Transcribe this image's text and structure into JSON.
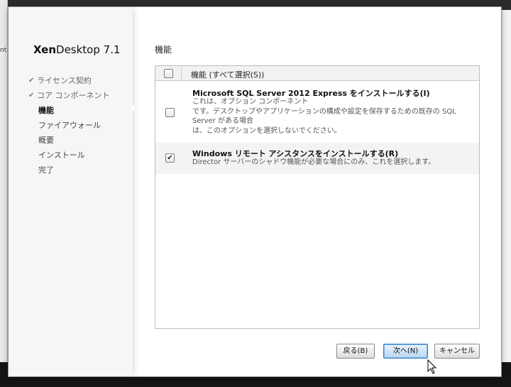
{
  "background": {
    "left_fragment_text": "nt"
  },
  "sidebar": {
    "product_bold": "Xen",
    "product_rest": "Desktop 7.1",
    "steps": [
      {
        "label": "ライセンス契約",
        "status": "done"
      },
      {
        "label": "コア コンポーネント",
        "status": "done"
      },
      {
        "label": "機能",
        "status": "current"
      },
      {
        "label": "ファイアウォール",
        "status": "pending"
      },
      {
        "label": "概要",
        "status": "pending"
      },
      {
        "label": "インストール",
        "status": "pending"
      },
      {
        "label": "完了",
        "status": "pending"
      }
    ],
    "check_glyph": "✔"
  },
  "main": {
    "section_title": "機能",
    "table": {
      "header_label": "機能 (すべて選択(S))",
      "header_checked": false,
      "rows": [
        {
          "title": "Microsoft SQL Server 2012 Express をインストールする(I)",
          "description_lines": [
            "これは、オプション コンポーネント",
            "です。デスクトップやアプリケーションの構成や設定を保存するための既存の SQL Server がある場合",
            "は、このオプションを選択しないでください。"
          ],
          "checked": false
        },
        {
          "title": "Windows リモート アシスタンスをインストールする(R)",
          "description_lines": [
            "Director サーバーのシャドウ機能が必要な場合にのみ、これを選択します。"
          ],
          "checked": true,
          "check_glyph": "✔"
        }
      ]
    }
  },
  "buttons": {
    "back": "戻る(B)",
    "next": "次へ(N)",
    "cancel": "キャンセル"
  },
  "colors": {
    "accent": "#3b7dc4",
    "sidebar_bg": "#f6f6f6",
    "selected_row_bg": "#f3f3f3"
  }
}
